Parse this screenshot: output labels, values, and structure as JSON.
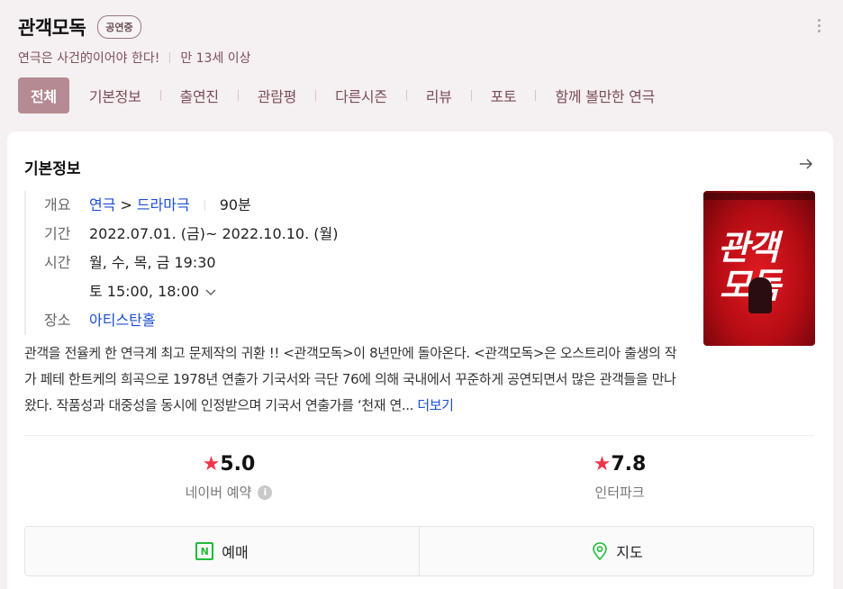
{
  "header": {
    "title": "관객모독",
    "status_badge": "공연중",
    "tagline": "연극은 사건的이어야 한다!",
    "age": "만 13세 이상"
  },
  "tabs": [
    {
      "label": "전체",
      "active": true
    },
    {
      "label": "기본정보"
    },
    {
      "label": "출연진"
    },
    {
      "label": "관람평"
    },
    {
      "label": "다른시즌"
    },
    {
      "label": "리뷰"
    },
    {
      "label": "포토"
    },
    {
      "label": "함께 볼만한 연극"
    }
  ],
  "card": {
    "title": "기본정보",
    "overview_label": "개요",
    "genre1": "연극",
    "genre_sep": ">",
    "genre2": "드라마극",
    "runtime": "90분",
    "period_label": "기간",
    "period": "2022.07.01. (금)~ 2022.10.10. (월)",
    "time_label": "시간",
    "time1": "월, 수, 목, 금 19:30",
    "time2": "토 15:00, 18:00",
    "place_label": "장소",
    "place": "아티스탄홀",
    "description": "관객을 전율케 한 연극계 최고 문제작의 귀환 !! <관객모독>이 8년만에 돌아온다. <관객모독>은 오스트리아 출생의 작가 페테 한트케의 희곡으로 1978년 연출가 기국서와 극단 76에 의해 국내에서 꾸준하게 공연되면서 많은 관객들을 만나왔다. 작품성과 대중성을 동시에 인정받으며 기국서 연출가를 ‘천재 연...",
    "more": "더보기",
    "poster": {
      "title_line1": "관객",
      "title_line2": "모독"
    }
  },
  "ratings": [
    {
      "score": "5.0",
      "source": "네이버 예약"
    },
    {
      "score": "7.8",
      "source": "인터파크"
    }
  ],
  "actions": {
    "reserve": "예매",
    "map": "지도"
  },
  "colors": {
    "accent": "#b68a92",
    "link": "#1b4fd1",
    "star": "#f0374a",
    "naver_green": "#1fbb3a"
  }
}
